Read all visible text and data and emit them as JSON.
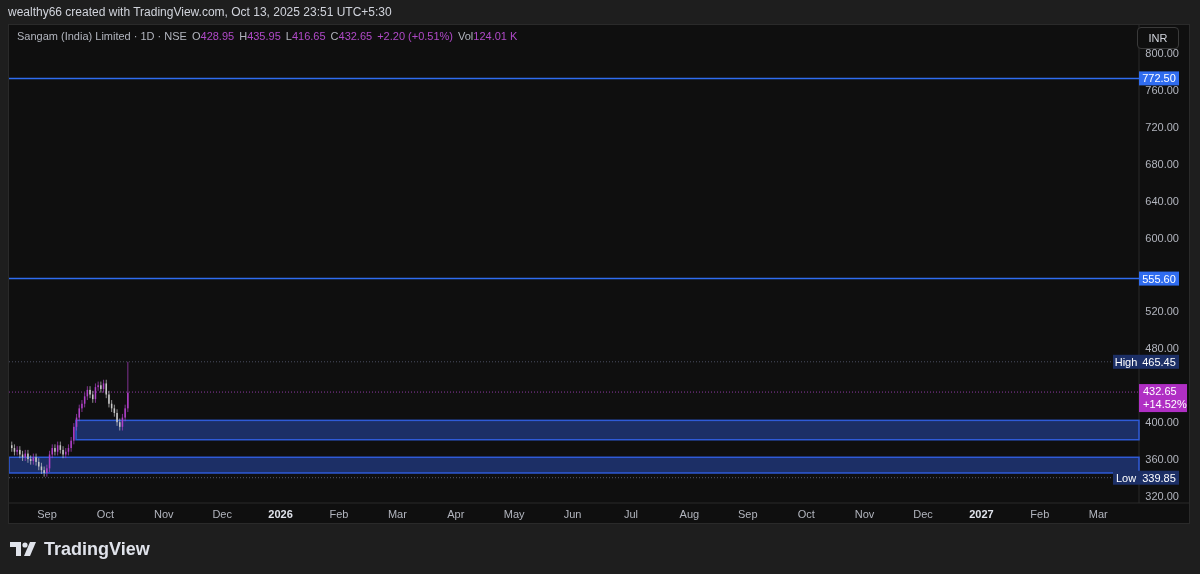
{
  "header": {
    "text": "wealthy66 created with TradingView.com, Oct 13, 2025 23:51 UTC+5:30"
  },
  "legend": {
    "symbol": "Sangam (India) Limited · 1D · NSE",
    "values": [
      {
        "key": "O",
        "value": "428.95"
      },
      {
        "key": "H",
        "value": "435.95"
      },
      {
        "key": "L",
        "value": "416.65"
      },
      {
        "key": "C",
        "value": "432.65"
      }
    ],
    "change": "+2.20 (+0.51%)",
    "volume": {
      "key": "Vol",
      "value": "124.01 K"
    }
  },
  "currency": "INR",
  "price_axis": [
    "800.00",
    "760.00",
    "720.00",
    "680.00",
    "640.00",
    "600.00",
    "520.00",
    "480.00",
    "400.00",
    "360.00",
    "320.00"
  ],
  "price_lines": [
    {
      "price": "772.50"
    },
    {
      "price": "555.60"
    }
  ],
  "markers": [
    {
      "kind": "high",
      "label": "High",
      "price": "465.45"
    },
    {
      "kind": "low",
      "label": "Low",
      "price": "339.85"
    }
  ],
  "last_price": {
    "price": "432.65",
    "change": "+14.52%"
  },
  "time_axis": [
    {
      "label": "Sep",
      "kind": "month"
    },
    {
      "label": "Oct",
      "kind": "month"
    },
    {
      "label": "Nov",
      "kind": "month"
    },
    {
      "label": "Dec",
      "kind": "month"
    },
    {
      "label": "2026",
      "kind": "year"
    },
    {
      "label": "Feb",
      "kind": "month"
    },
    {
      "label": "Mar",
      "kind": "month"
    },
    {
      "label": "Apr",
      "kind": "month"
    },
    {
      "label": "May",
      "kind": "month"
    },
    {
      "label": "Jun",
      "kind": "month"
    },
    {
      "label": "Jul",
      "kind": "month"
    },
    {
      "label": "Aug",
      "kind": "month"
    },
    {
      "label": "Sep",
      "kind": "month"
    },
    {
      "label": "Oct",
      "kind": "month"
    },
    {
      "label": "Nov",
      "kind": "month"
    },
    {
      "label": "Dec",
      "kind": "month"
    },
    {
      "label": "2027",
      "kind": "year"
    },
    {
      "label": "Feb",
      "kind": "month"
    },
    {
      "label": "Mar",
      "kind": "month"
    }
  ],
  "footer": {
    "brand": "TradingView"
  }
}
